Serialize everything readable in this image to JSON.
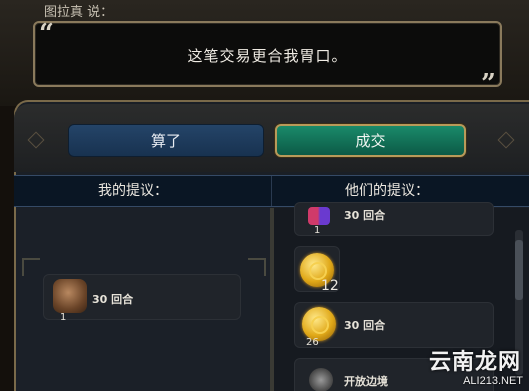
{
  "dialog": {
    "speaker": "图拉真 说：",
    "open_quote": "“",
    "close_quote": "”",
    "message": "这笔交易更合我胃口。"
  },
  "buttons": {
    "cancel_label": "算了",
    "accept_label": "成交"
  },
  "headers": {
    "my_offer": "我的提议：",
    "their_offer": "他们的提议："
  },
  "my_items": [
    {
      "icon": "horse-icon",
      "label": "30 回合",
      "count": "1"
    }
  ],
  "their_items": [
    {
      "icon": "potion-icon",
      "label": "30 回合",
      "count": "1"
    },
    {
      "icon": "gold-icon",
      "label": "",
      "count": "12"
    },
    {
      "icon": "gold-icon",
      "label": "30 回合",
      "count": "26"
    },
    {
      "icon": "city-icon",
      "label": "开放边境",
      "count": ""
    }
  ],
  "watermark": {
    "main": "云南龙网",
    "sub": "ALI213.NET"
  },
  "colors": {
    "accent_green": "#0c5a46",
    "accent_blue": "#183250",
    "frame_gold": "#b89a5a"
  }
}
